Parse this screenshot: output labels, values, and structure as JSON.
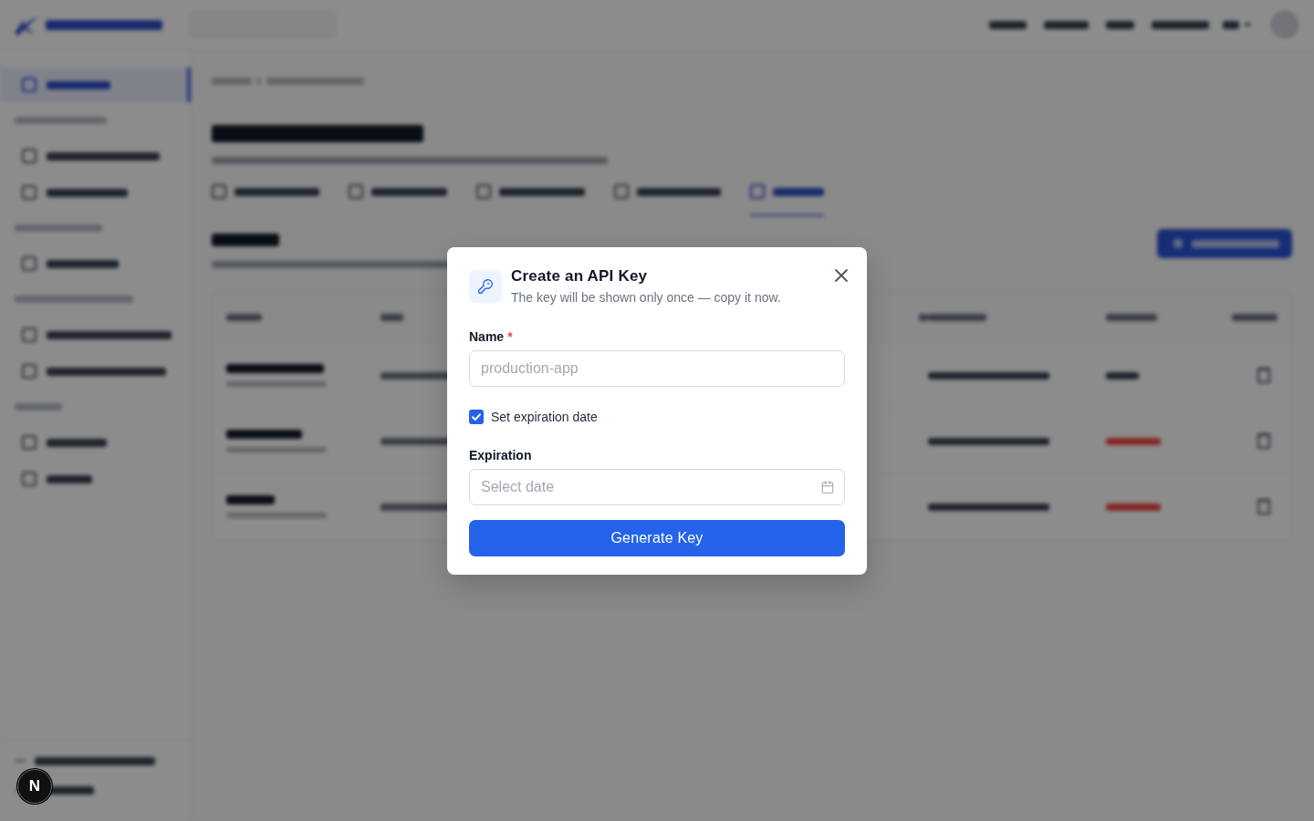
{
  "dialog": {
    "title": "Create an API Key",
    "subtitle": "The key will be shown only once — copy it now.",
    "form": [
      {
        "kind": "text",
        "label": "Name",
        "required_mark": "*",
        "placeholder": "production-app"
      },
      {
        "kind": "checkbox",
        "label": "Set expiration date",
        "checked": true
      },
      {
        "kind": "date",
        "label": "Expiration",
        "placeholder": "Select date"
      }
    ],
    "submit": "Generate Key"
  },
  "dev_badge": {
    "label": "N"
  }
}
